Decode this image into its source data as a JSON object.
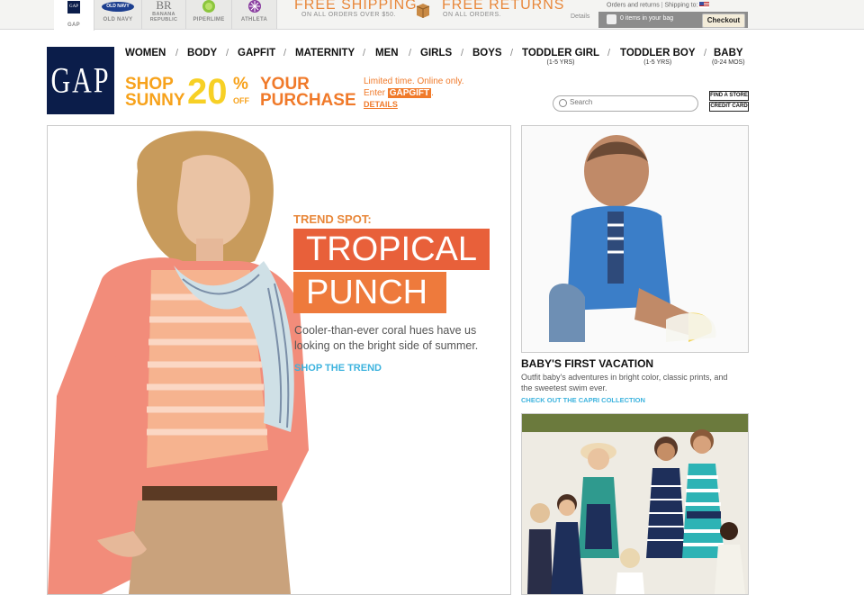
{
  "brand_tabs": [
    {
      "label": "GAP",
      "logo": "GAP",
      "active": true
    },
    {
      "label": "OLD NAVY",
      "logo": "OLD NAVY"
    },
    {
      "label": "BANANA REPUBLIC",
      "logo": "BR"
    },
    {
      "label": "PIPERLIME",
      "logo": "piperlime-icon"
    },
    {
      "label": "ATHLETA",
      "logo": "athleta-icon"
    }
  ],
  "promo_bar": {
    "shipping_title": "FREE SHIPPING",
    "shipping_sub": "ON ALL ORDERS OVER $50.",
    "returns_title": "FREE RETURNS",
    "returns_sub": "ON ALL ORDERS.",
    "details": "Details"
  },
  "account": {
    "orders": "Orders and returns",
    "shipping_to": "Shipping to:",
    "bag_text": "0 items in your bag",
    "checkout": "Checkout"
  },
  "logo_text": "GAP",
  "nav": [
    {
      "label": "WOMEN"
    },
    {
      "label": "BODY"
    },
    {
      "label": "GAPFIT"
    },
    {
      "label": "MATERNITY"
    },
    {
      "label": "MEN"
    },
    {
      "label": "GIRLS"
    },
    {
      "label": "BOYS"
    },
    {
      "label": "TODDLER GIRL",
      "sub": "(1-5 YRS)"
    },
    {
      "label": "TODDLER BOY",
      "sub": "(1-5 YRS)"
    },
    {
      "label": "BABY",
      "sub": "(0-24 MOS)"
    }
  ],
  "shop_promo": {
    "line1": "SHOP",
    "line2": "SUNNY",
    "percent": "20",
    "percent_sign": "%",
    "off": "OFF",
    "your": "YOUR",
    "purchase": "PURCHASE"
  },
  "limited": {
    "line1": "Limited time. Online only.",
    "enter": "Enter",
    "code": "GAPGIFT",
    "period": ".",
    "details": "DETAILS"
  },
  "search": {
    "placeholder": "Search"
  },
  "side_buttons": {
    "find_store": "FIND A STORE",
    "credit_card": "CREDIT CARD"
  },
  "hero": {
    "kicker": "TREND SPOT:",
    "title1": "TROPICAL",
    "title2": "PUNCH",
    "description": "Cooler-than-ever coral hues have us looking on the bright side of summer.",
    "cta": "SHOP THE TREND"
  },
  "baby": {
    "title": "BABY'S FIRST VACATION",
    "description": "Outfit baby's adventures in bright color, classic prints, and the sweetest swim ever.",
    "cta": "CHECK OUT THE CAPRI COLLECTION"
  },
  "colors": {
    "accent_orange": "#f07a2a",
    "link_blue": "#3db3de",
    "navy": "#0b1d4a"
  }
}
